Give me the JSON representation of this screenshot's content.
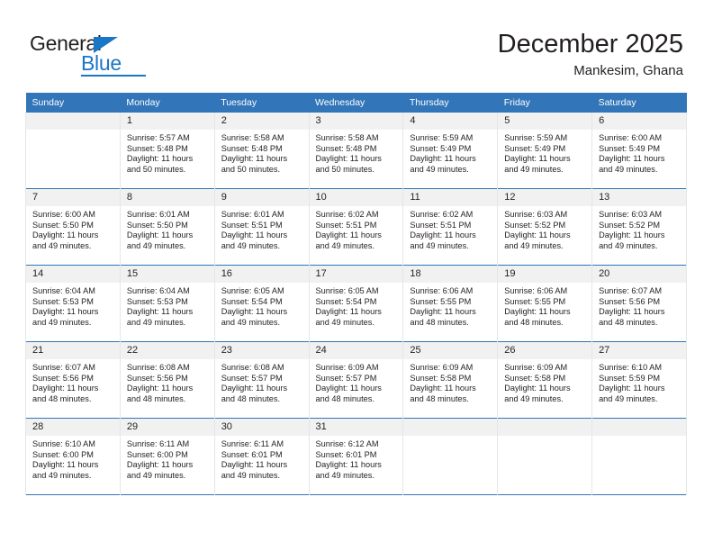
{
  "logo": {
    "word1": "General",
    "word2": "Blue",
    "accent_color": "#1a77c5",
    "triangle_icon": "logo-triangle"
  },
  "header": {
    "title": "December 2025",
    "subtitle": "Mankesim, Ghana"
  },
  "calendar": {
    "header_bg": "#3275b8",
    "header_text_color": "#ffffff",
    "daynum_bg": "#f1f1f1",
    "columns": [
      "Sunday",
      "Monday",
      "Tuesday",
      "Wednesday",
      "Thursday",
      "Friday",
      "Saturday"
    ],
    "weeks": [
      [
        {
          "day": "",
          "lines": []
        },
        {
          "day": "1",
          "lines": [
            "Sunrise: 5:57 AM",
            "Sunset: 5:48 PM",
            "Daylight: 11 hours",
            "and 50 minutes."
          ]
        },
        {
          "day": "2",
          "lines": [
            "Sunrise: 5:58 AM",
            "Sunset: 5:48 PM",
            "Daylight: 11 hours",
            "and 50 minutes."
          ]
        },
        {
          "day": "3",
          "lines": [
            "Sunrise: 5:58 AM",
            "Sunset: 5:48 PM",
            "Daylight: 11 hours",
            "and 50 minutes."
          ]
        },
        {
          "day": "4",
          "lines": [
            "Sunrise: 5:59 AM",
            "Sunset: 5:49 PM",
            "Daylight: 11 hours",
            "and 49 minutes."
          ]
        },
        {
          "day": "5",
          "lines": [
            "Sunrise: 5:59 AM",
            "Sunset: 5:49 PM",
            "Daylight: 11 hours",
            "and 49 minutes."
          ]
        },
        {
          "day": "6",
          "lines": [
            "Sunrise: 6:00 AM",
            "Sunset: 5:49 PM",
            "Daylight: 11 hours",
            "and 49 minutes."
          ]
        }
      ],
      [
        {
          "day": "7",
          "lines": [
            "Sunrise: 6:00 AM",
            "Sunset: 5:50 PM",
            "Daylight: 11 hours",
            "and 49 minutes."
          ]
        },
        {
          "day": "8",
          "lines": [
            "Sunrise: 6:01 AM",
            "Sunset: 5:50 PM",
            "Daylight: 11 hours",
            "and 49 minutes."
          ]
        },
        {
          "day": "9",
          "lines": [
            "Sunrise: 6:01 AM",
            "Sunset: 5:51 PM",
            "Daylight: 11 hours",
            "and 49 minutes."
          ]
        },
        {
          "day": "10",
          "lines": [
            "Sunrise: 6:02 AM",
            "Sunset: 5:51 PM",
            "Daylight: 11 hours",
            "and 49 minutes."
          ]
        },
        {
          "day": "11",
          "lines": [
            "Sunrise: 6:02 AM",
            "Sunset: 5:51 PM",
            "Daylight: 11 hours",
            "and 49 minutes."
          ]
        },
        {
          "day": "12",
          "lines": [
            "Sunrise: 6:03 AM",
            "Sunset: 5:52 PM",
            "Daylight: 11 hours",
            "and 49 minutes."
          ]
        },
        {
          "day": "13",
          "lines": [
            "Sunrise: 6:03 AM",
            "Sunset: 5:52 PM",
            "Daylight: 11 hours",
            "and 49 minutes."
          ]
        }
      ],
      [
        {
          "day": "14",
          "lines": [
            "Sunrise: 6:04 AM",
            "Sunset: 5:53 PM",
            "Daylight: 11 hours",
            "and 49 minutes."
          ]
        },
        {
          "day": "15",
          "lines": [
            "Sunrise: 6:04 AM",
            "Sunset: 5:53 PM",
            "Daylight: 11 hours",
            "and 49 minutes."
          ]
        },
        {
          "day": "16",
          "lines": [
            "Sunrise: 6:05 AM",
            "Sunset: 5:54 PM",
            "Daylight: 11 hours",
            "and 49 minutes."
          ]
        },
        {
          "day": "17",
          "lines": [
            "Sunrise: 6:05 AM",
            "Sunset: 5:54 PM",
            "Daylight: 11 hours",
            "and 49 minutes."
          ]
        },
        {
          "day": "18",
          "lines": [
            "Sunrise: 6:06 AM",
            "Sunset: 5:55 PM",
            "Daylight: 11 hours",
            "and 48 minutes."
          ]
        },
        {
          "day": "19",
          "lines": [
            "Sunrise: 6:06 AM",
            "Sunset: 5:55 PM",
            "Daylight: 11 hours",
            "and 48 minutes."
          ]
        },
        {
          "day": "20",
          "lines": [
            "Sunrise: 6:07 AM",
            "Sunset: 5:56 PM",
            "Daylight: 11 hours",
            "and 48 minutes."
          ]
        }
      ],
      [
        {
          "day": "21",
          "lines": [
            "Sunrise: 6:07 AM",
            "Sunset: 5:56 PM",
            "Daylight: 11 hours",
            "and 48 minutes."
          ]
        },
        {
          "day": "22",
          "lines": [
            "Sunrise: 6:08 AM",
            "Sunset: 5:56 PM",
            "Daylight: 11 hours",
            "and 48 minutes."
          ]
        },
        {
          "day": "23",
          "lines": [
            "Sunrise: 6:08 AM",
            "Sunset: 5:57 PM",
            "Daylight: 11 hours",
            "and 48 minutes."
          ]
        },
        {
          "day": "24",
          "lines": [
            "Sunrise: 6:09 AM",
            "Sunset: 5:57 PM",
            "Daylight: 11 hours",
            "and 48 minutes."
          ]
        },
        {
          "day": "25",
          "lines": [
            "Sunrise: 6:09 AM",
            "Sunset: 5:58 PM",
            "Daylight: 11 hours",
            "and 48 minutes."
          ]
        },
        {
          "day": "26",
          "lines": [
            "Sunrise: 6:09 AM",
            "Sunset: 5:58 PM",
            "Daylight: 11 hours",
            "and 49 minutes."
          ]
        },
        {
          "day": "27",
          "lines": [
            "Sunrise: 6:10 AM",
            "Sunset: 5:59 PM",
            "Daylight: 11 hours",
            "and 49 minutes."
          ]
        }
      ],
      [
        {
          "day": "28",
          "lines": [
            "Sunrise: 6:10 AM",
            "Sunset: 6:00 PM",
            "Daylight: 11 hours",
            "and 49 minutes."
          ]
        },
        {
          "day": "29",
          "lines": [
            "Sunrise: 6:11 AM",
            "Sunset: 6:00 PM",
            "Daylight: 11 hours",
            "and 49 minutes."
          ]
        },
        {
          "day": "30",
          "lines": [
            "Sunrise: 6:11 AM",
            "Sunset: 6:01 PM",
            "Daylight: 11 hours",
            "and 49 minutes."
          ]
        },
        {
          "day": "31",
          "lines": [
            "Sunrise: 6:12 AM",
            "Sunset: 6:01 PM",
            "Daylight: 11 hours",
            "and 49 minutes."
          ]
        },
        {
          "day": "",
          "lines": []
        },
        {
          "day": "",
          "lines": []
        },
        {
          "day": "",
          "lines": []
        }
      ]
    ]
  }
}
